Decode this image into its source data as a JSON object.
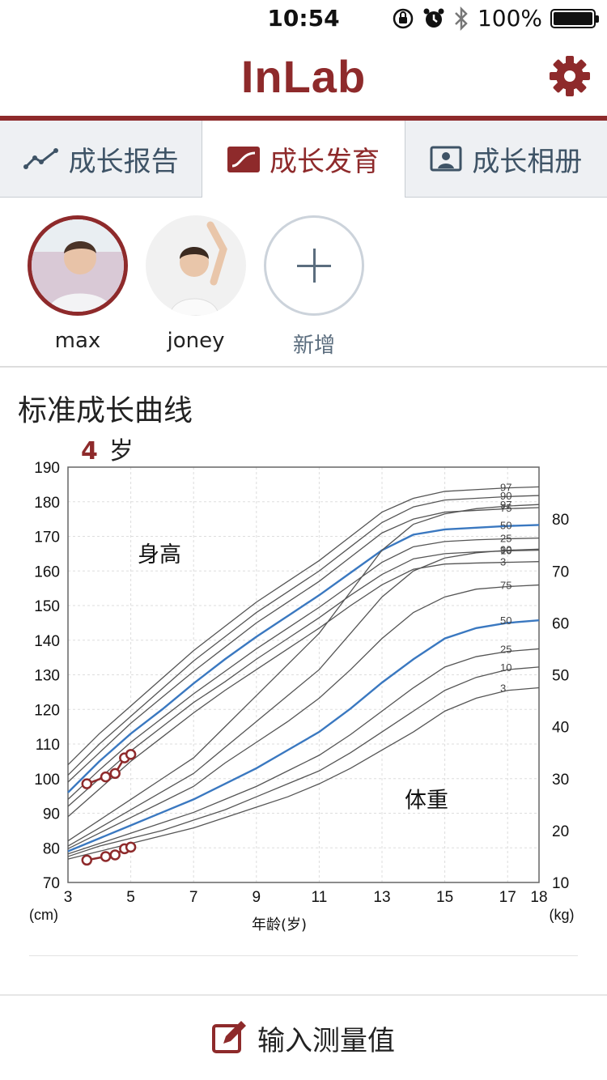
{
  "status": {
    "time": "10:54",
    "battery": "100%"
  },
  "app": {
    "title": "InLab"
  },
  "tabs": [
    {
      "label": "成长报告",
      "icon": "trend-line-icon"
    },
    {
      "label": "成长发育",
      "icon": "growth-curve-icon"
    },
    {
      "label": "成长相册",
      "icon": "photo-album-icon"
    }
  ],
  "kids": [
    {
      "name": "max",
      "selected": true
    },
    {
      "name": "joney",
      "selected": false
    }
  ],
  "add_label": "新增",
  "section": {
    "title": "标准成长曲线",
    "age_value": "4",
    "age_unit": "岁"
  },
  "bottom": {
    "action_label": "输入测量值"
  },
  "colors": {
    "accent": "#8e2a2b",
    "curve": "#3a78c0",
    "percentile": "#555555"
  },
  "chart_data": {
    "type": "line",
    "xlabel": "年龄(岁)",
    "x_ticks": [
      3,
      5,
      7,
      9,
      11,
      13,
      15,
      17,
      18
    ],
    "xlim": [
      3,
      18
    ],
    "left_axis": {
      "unit": "(cm)",
      "ticks": [
        70,
        80,
        90,
        100,
        110,
        120,
        130,
        140,
        150,
        160,
        170,
        180,
        190
      ],
      "range": [
        70,
        190
      ]
    },
    "right_axis": {
      "unit": "(kg)",
      "ticks": [
        10,
        20,
        30,
        40,
        50,
        60,
        70,
        80
      ],
      "range": [
        10,
        90
      ]
    },
    "height_label": "身高",
    "weight_label": "体重",
    "x_samples": [
      3,
      4,
      5,
      6,
      7,
      8,
      9,
      10,
      11,
      12,
      13,
      14,
      15,
      16,
      17,
      18
    ],
    "height_curves": [
      {
        "name": "97",
        "values": [
          104,
          113,
          121,
          129,
          137,
          144,
          151,
          157,
          163,
          170,
          177,
          181,
          183,
          183.5,
          184,
          184.3
        ]
      },
      {
        "name": "90",
        "values": [
          101,
          110,
          118,
          126,
          134,
          141,
          148,
          154,
          160,
          167,
          174,
          178.5,
          180.5,
          181,
          181.5,
          181.8
        ]
      },
      {
        "name": "75",
        "values": [
          99,
          107.5,
          116,
          123.5,
          131,
          138,
          145,
          151,
          157,
          164,
          171,
          175,
          177,
          177.5,
          178,
          178.3
        ]
      },
      {
        "name": "50",
        "values": [
          96,
          105,
          113,
          120,
          127.5,
          134.5,
          141,
          147,
          153,
          159.5,
          166,
          170.5,
          172,
          172.5,
          173,
          173.3
        ]
      },
      {
        "name": "25",
        "values": [
          94,
          102.5,
          110.5,
          117.5,
          124.5,
          131,
          137.5,
          143.5,
          149.5,
          156,
          162.5,
          167,
          168.5,
          169,
          169.3,
          169.5
        ]
      },
      {
        "name": "10",
        "values": [
          92,
          100,
          108,
          115,
          122,
          128,
          134.5,
          140.5,
          146.5,
          153,
          159,
          163.5,
          165,
          165.5,
          165.8,
          166
        ]
      },
      {
        "name": "3",
        "values": [
          89,
          97,
          105,
          112,
          119,
          125.5,
          131.5,
          137.5,
          143.5,
          150,
          156,
          160.5,
          162,
          162.3,
          162.5,
          162.7
        ]
      }
    ],
    "weight_curves": [
      {
        "name": "97",
        "values": [
          18,
          22,
          26,
          30,
          34,
          40,
          46,
          52,
          58,
          66,
          74,
          79,
          81,
          82,
          82.5,
          82.8
        ]
      },
      {
        "name": "90",
        "values": [
          17,
          20.5,
          24,
          27.5,
          31,
          36,
          41,
          46,
          51,
          58,
          65,
          70,
          72.5,
          73.5,
          74,
          74.2
        ]
      },
      {
        "name": "75",
        "values": [
          16.5,
          19.5,
          22.5,
          25.5,
          28.5,
          33,
          37,
          41,
          45.5,
          51,
          57,
          62,
          65,
          66.5,
          67,
          67.3
        ]
      },
      {
        "name": "50",
        "values": [
          16,
          18.5,
          21,
          23.5,
          26,
          29,
          32,
          35.5,
          39,
          43.5,
          48.5,
          53,
          57,
          59,
          60,
          60.5
        ]
      },
      {
        "name": "25",
        "values": [
          15.5,
          17.5,
          19.5,
          21.5,
          23.5,
          26,
          28.5,
          31.5,
          34.5,
          38.5,
          43,
          47.5,
          51.5,
          53.5,
          54.5,
          55
        ]
      },
      {
        "name": "10",
        "values": [
          15,
          17,
          18.5,
          20,
          22,
          24,
          26.5,
          29,
          31.5,
          35,
          39,
          43,
          47,
          49.5,
          51,
          51.5
        ]
      },
      {
        "name": "3",
        "values": [
          14.5,
          16,
          17.5,
          19,
          20.5,
          22.5,
          24.5,
          26.5,
          29,
          32,
          35.5,
          39,
          43,
          45.5,
          47,
          47.5
        ]
      }
    ],
    "measurements_height": [
      {
        "x": 3.6,
        "y": 98.5
      },
      {
        "x": 4.2,
        "y": 100.5
      },
      {
        "x": 4.5,
        "y": 101.5
      },
      {
        "x": 4.8,
        "y": 106
      },
      {
        "x": 5.0,
        "y": 107
      }
    ],
    "measurements_weight": [
      {
        "x": 3.6,
        "y": 14.3
      },
      {
        "x": 4.2,
        "y": 15
      },
      {
        "x": 4.5,
        "y": 15.3
      },
      {
        "x": 4.8,
        "y": 16.5
      },
      {
        "x": 5.0,
        "y": 16.8
      }
    ]
  }
}
